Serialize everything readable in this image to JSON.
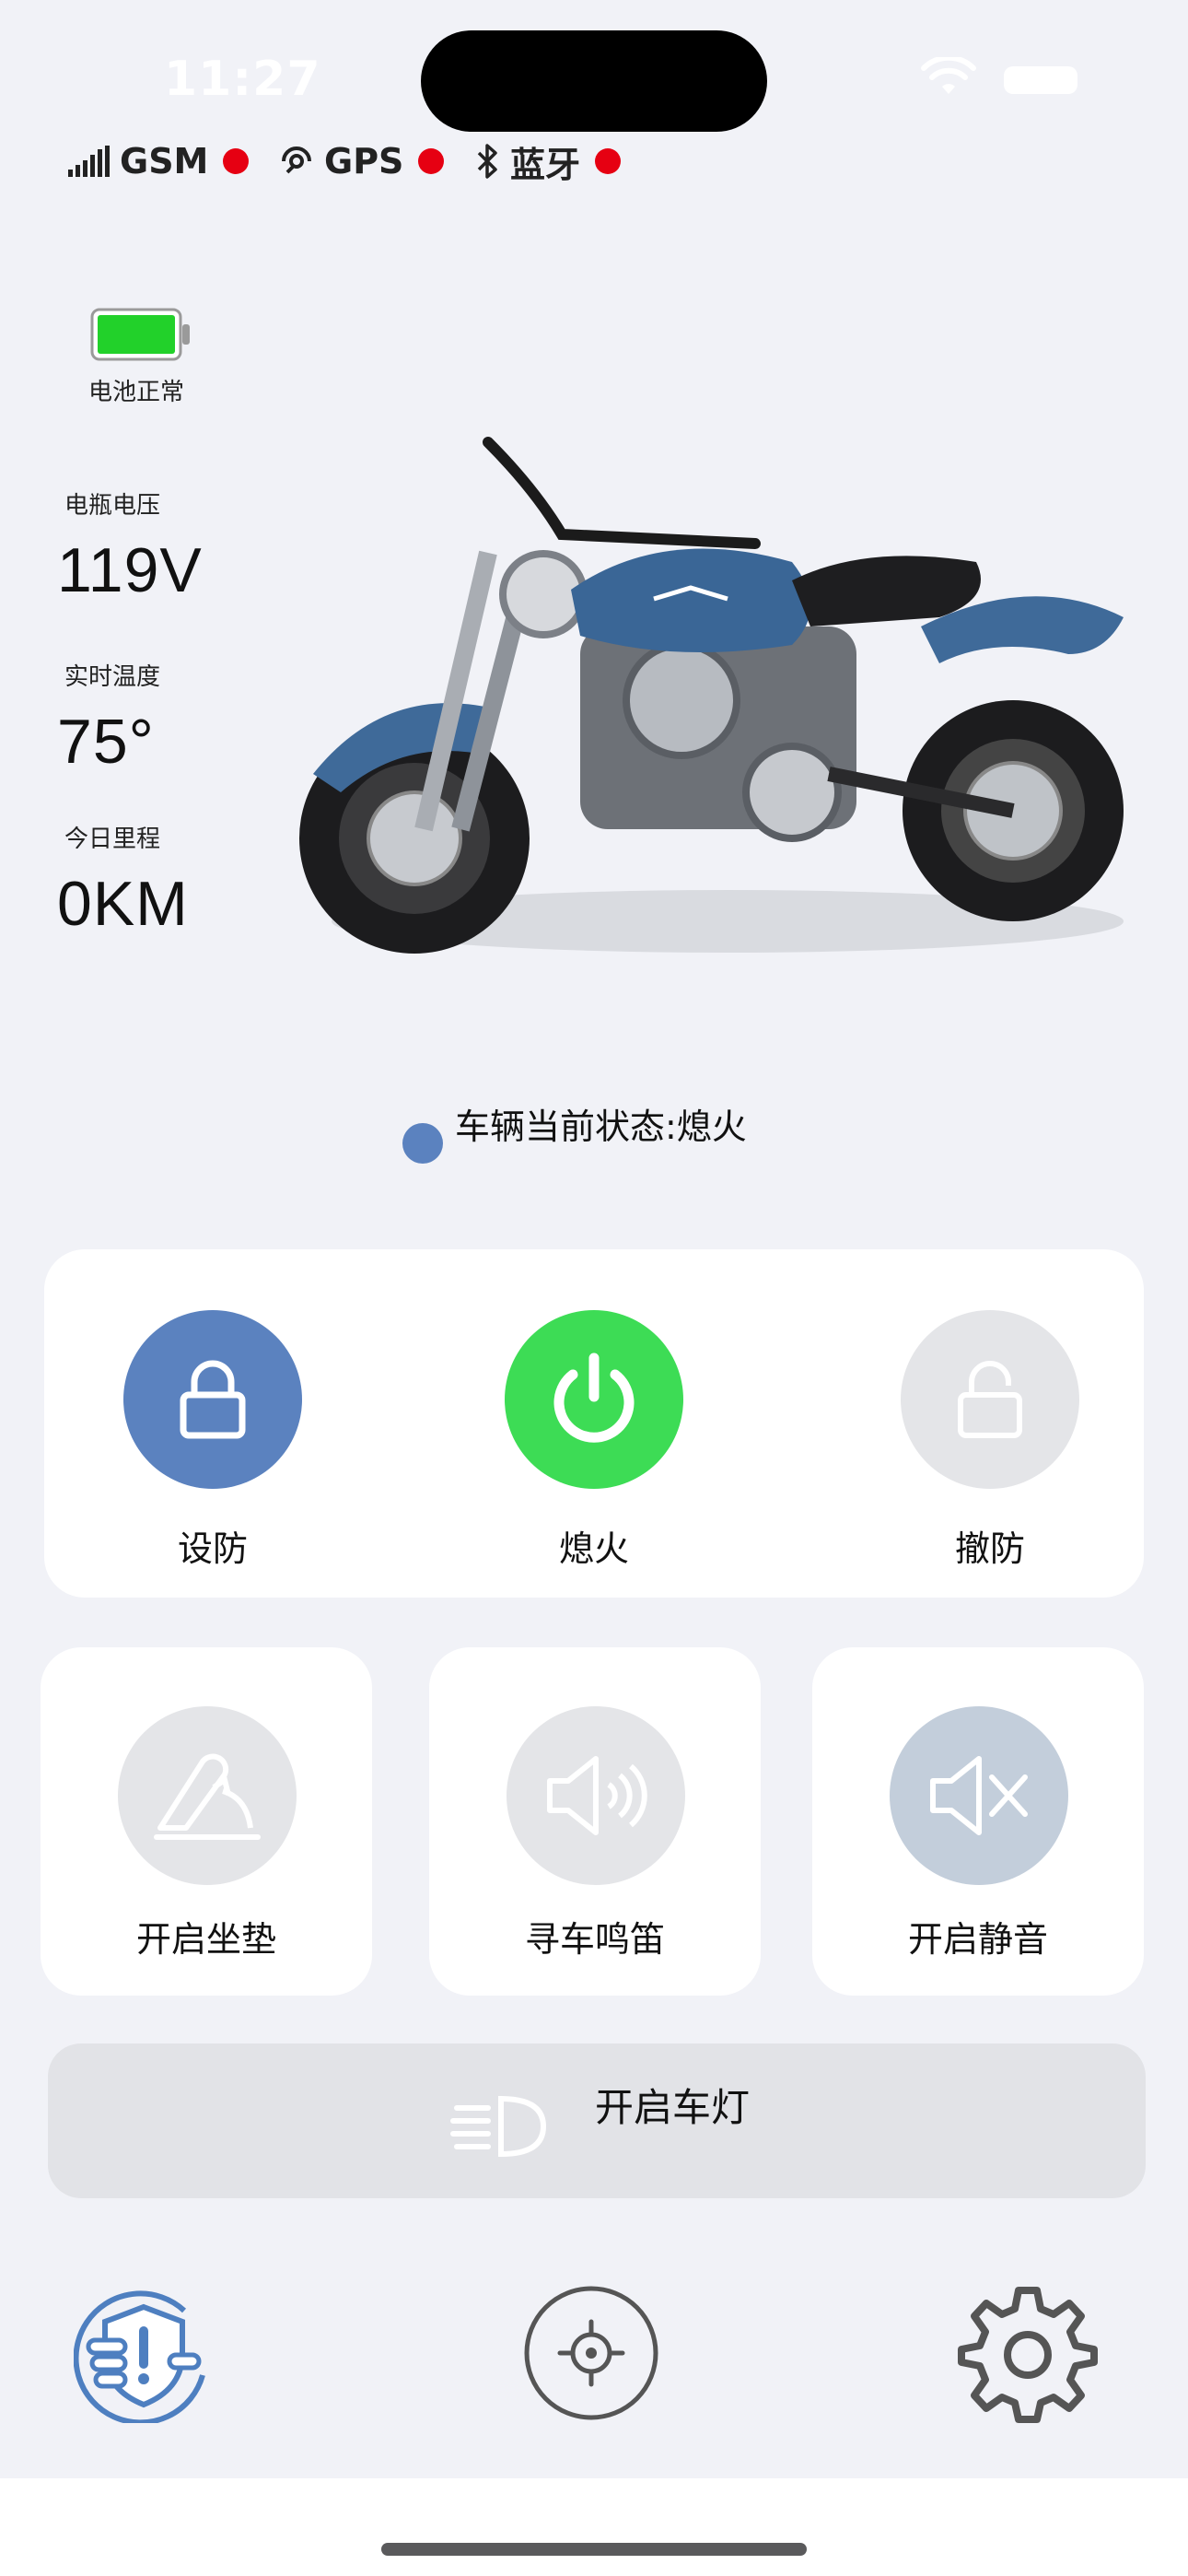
{
  "status_bar": {
    "time": "11:27"
  },
  "connectivity": [
    {
      "label": "GSM",
      "icon": "signal-bars-icon",
      "state_color": "#e60012"
    },
    {
      "label": "GPS",
      "icon": "gps-icon",
      "state_color": "#e60012"
    },
    {
      "label": "蓝牙",
      "icon": "bluetooth-icon",
      "state_color": "#e60012"
    }
  ],
  "battery": {
    "label": "电池正常",
    "fill_color": "#22d12a",
    "level": 1.0
  },
  "metrics": [
    {
      "label": "电瓶电压",
      "value": "119V"
    },
    {
      "label": "实时温度",
      "value": "75°"
    },
    {
      "label": "今日里程",
      "value": "0KM"
    }
  ],
  "vehicle_status": {
    "text": "车辆当前状态:熄火",
    "indicator_color": "#5b82bf"
  },
  "main_controls": [
    {
      "label": "设防",
      "icon": "lock-icon",
      "bg": "#5b82bf"
    },
    {
      "label": "熄火",
      "icon": "power-icon",
      "bg": "#3ddc55"
    },
    {
      "label": "撤防",
      "icon": "unlock-icon",
      "bg": "#e4e5e8"
    }
  ],
  "secondary_controls": [
    {
      "label": "开启坐垫",
      "icon": "seat-icon",
      "bg": "#e4e5e8"
    },
    {
      "label": "寻车鸣笛",
      "icon": "speaker-icon",
      "bg": "#e4e5e8"
    },
    {
      "label": "开启静音",
      "icon": "mute-icon",
      "bg": "#c3cedb"
    }
  ],
  "light_control": {
    "label": "开启车灯",
    "icon": "headlight-icon"
  },
  "tab_bar": [
    {
      "name": "security",
      "icon": "shield-hand-icon",
      "active": true,
      "color": "#4e7fc0"
    },
    {
      "name": "location",
      "icon": "target-icon",
      "active": false,
      "color": "#555555"
    },
    {
      "name": "settings",
      "icon": "gear-icon",
      "active": false,
      "color": "#555555"
    }
  ],
  "colors": {
    "accent": "#5b82bf",
    "alert": "#e60012",
    "background": "#f1f2f7"
  }
}
